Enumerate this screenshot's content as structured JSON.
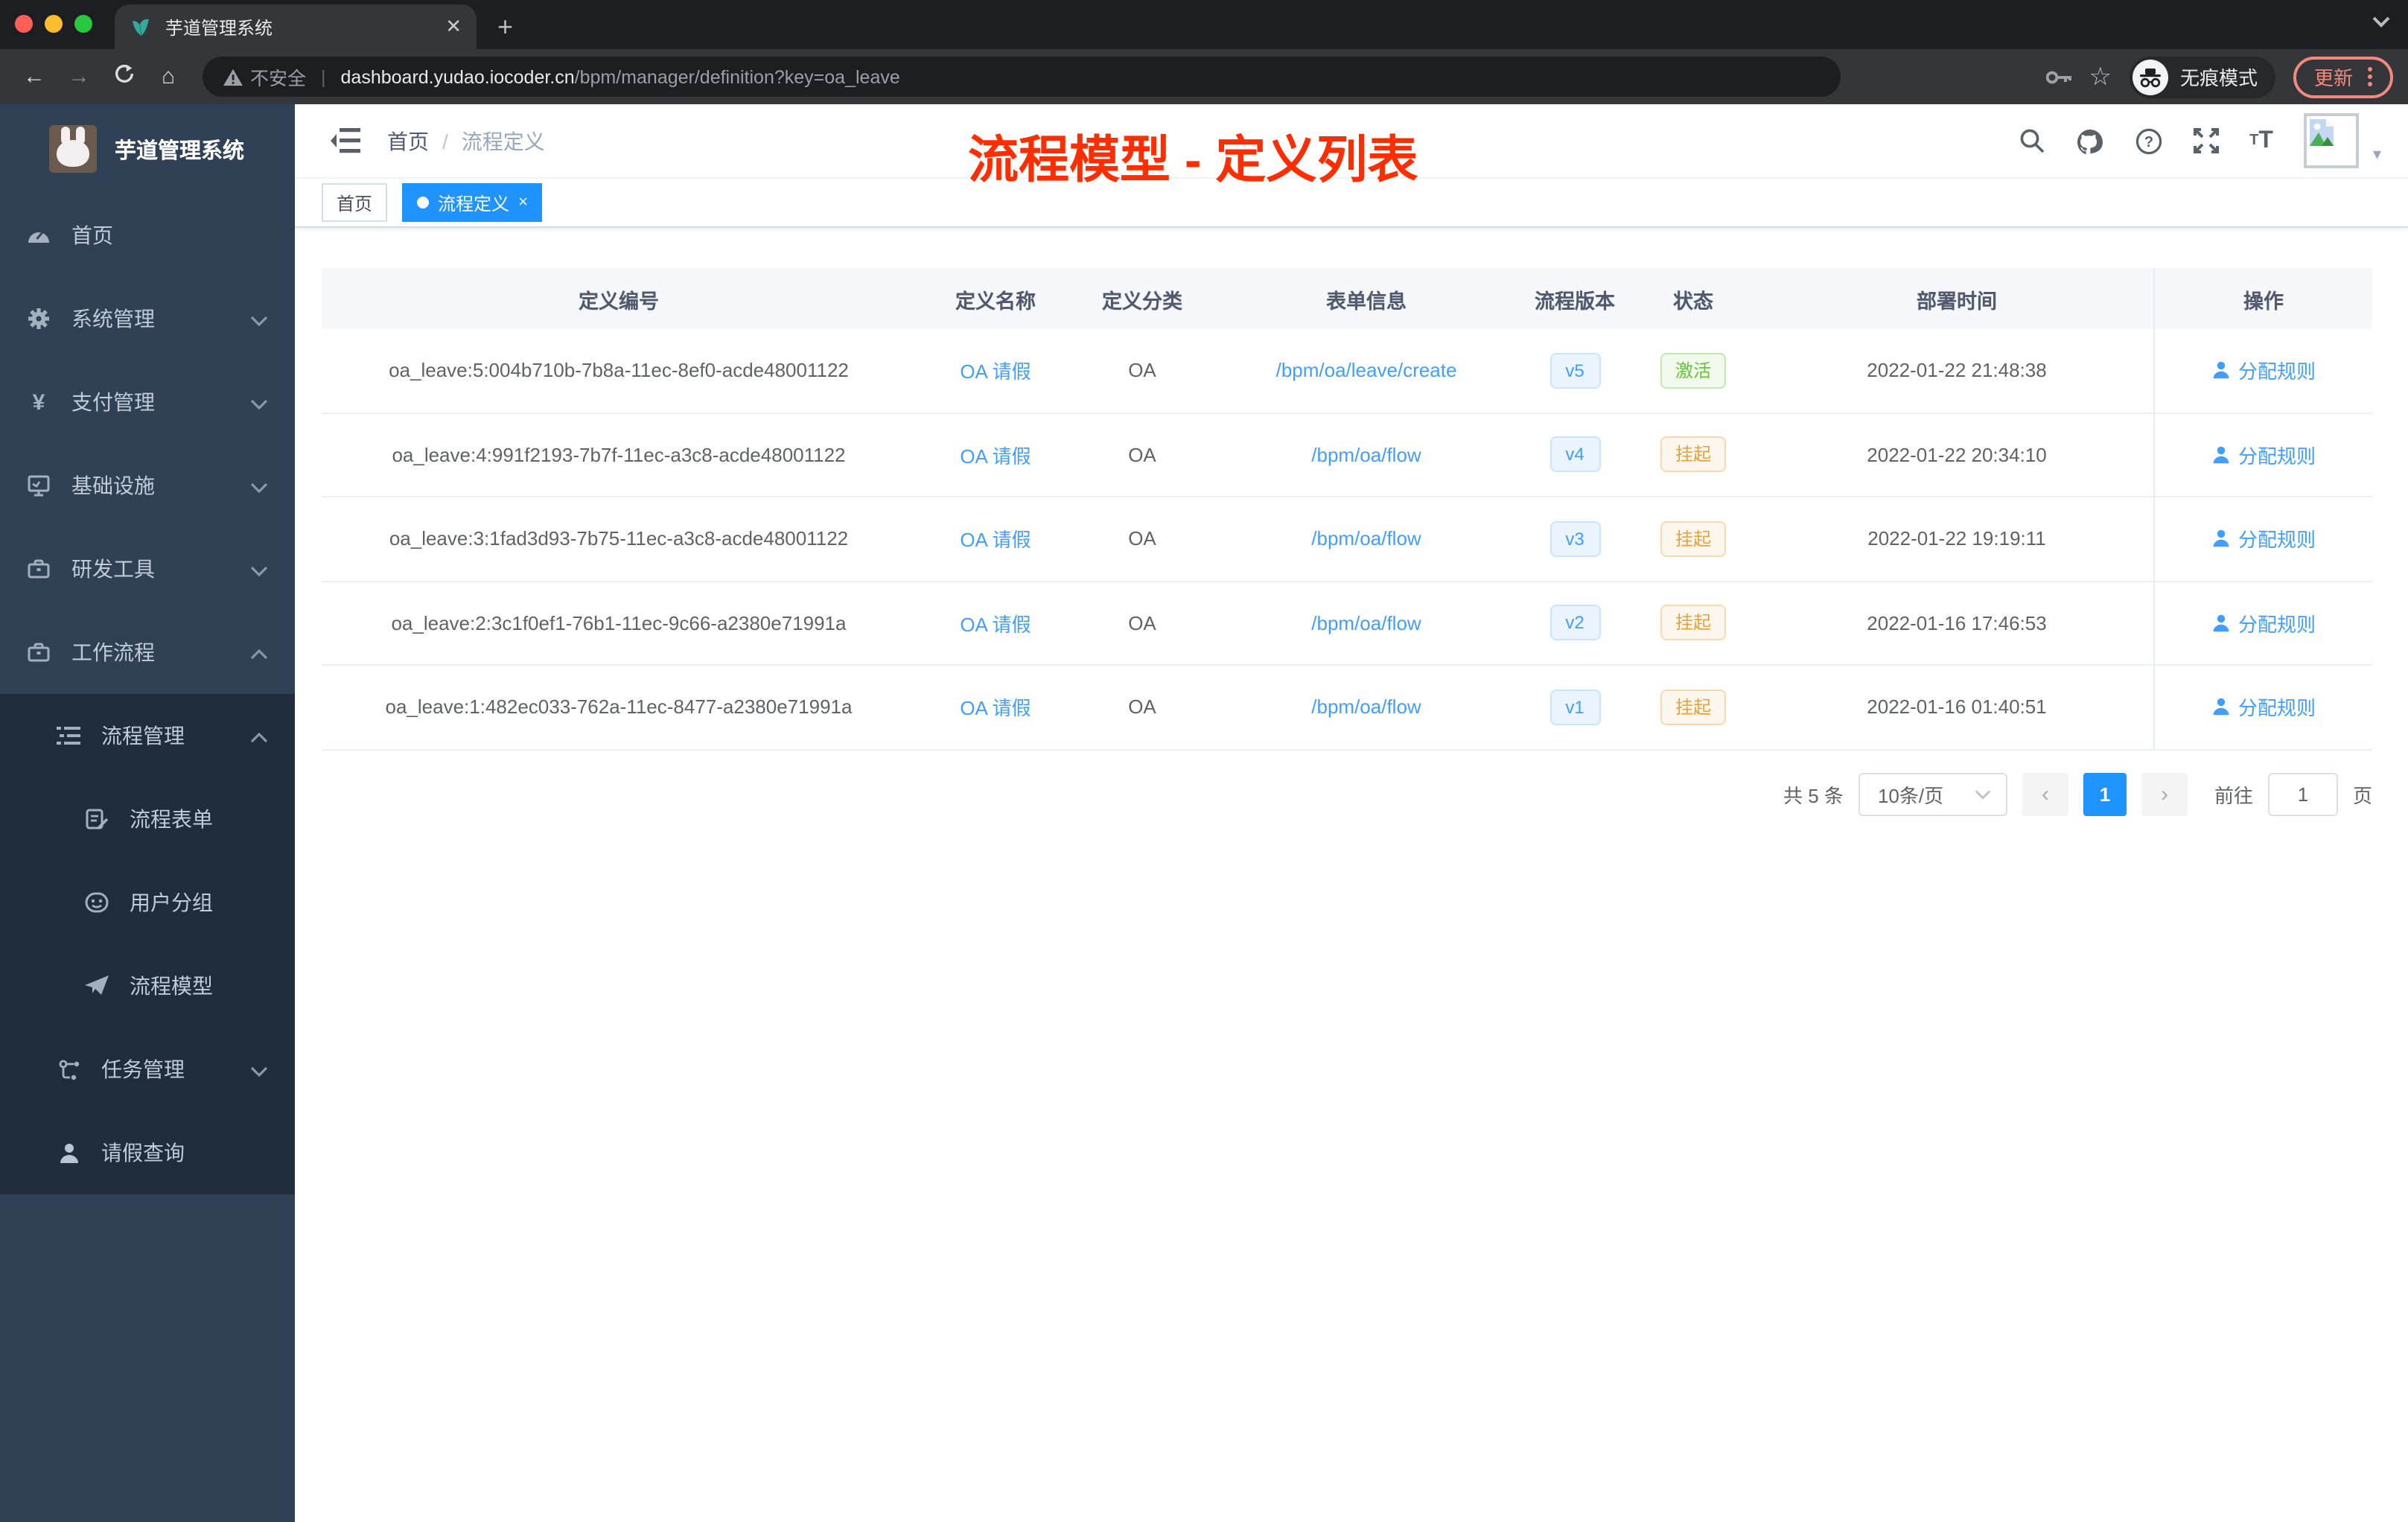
{
  "browser": {
    "tab_title": "芋道管理系统",
    "url": {
      "security_label": "不安全",
      "host": "dashboard.yudao.iocoder.cn",
      "path": "/bpm/manager/definition?key=oa_leave"
    },
    "incognito_label": "无痕模式",
    "update_button_label": "更新"
  },
  "sidebar": {
    "app_title": "芋道管理系统",
    "items": [
      {
        "label": "首页",
        "icon": "dashboard-icon",
        "level": 1,
        "chevron": null
      },
      {
        "label": "系统管理",
        "icon": "gear-icon",
        "level": 1,
        "chevron": "down"
      },
      {
        "label": "支付管理",
        "icon": "yen-icon",
        "level": 1,
        "chevron": "down"
      },
      {
        "label": "基础设施",
        "icon": "monitor-icon",
        "level": 1,
        "chevron": "down"
      },
      {
        "label": "研发工具",
        "icon": "toolbox-icon",
        "level": 1,
        "chevron": "down"
      },
      {
        "label": "工作流程",
        "icon": "toolbox-icon",
        "level": 1,
        "chevron": "up"
      },
      {
        "label": "流程管理",
        "icon": "tree-list-icon",
        "level": 2,
        "chevron": "up"
      },
      {
        "label": "流程表单",
        "icon": "form-icon",
        "level": 3,
        "chevron": null
      },
      {
        "label": "用户分组",
        "icon": "face-icon",
        "level": 3,
        "chevron": null
      },
      {
        "label": "流程模型",
        "icon": "paper-plane-icon",
        "level": 3,
        "chevron": null
      },
      {
        "label": "任务管理",
        "icon": "flow-icon",
        "level": 2,
        "chevron": "down"
      },
      {
        "label": "请假查询",
        "icon": "person-icon",
        "level": 2,
        "chevron": null
      }
    ]
  },
  "header": {
    "breadcrumb": {
      "home": "首页",
      "current": "流程定义"
    },
    "annotation": "流程模型 - 定义列表"
  },
  "tags_view": {
    "tabs": [
      {
        "label": "首页",
        "active": false
      },
      {
        "label": "流程定义",
        "active": true
      }
    ]
  },
  "table": {
    "columns": [
      "定义编号",
      "定义名称",
      "定义分类",
      "表单信息",
      "流程版本",
      "状态",
      "部署时间",
      "操作"
    ],
    "action_label": "分配规则",
    "rows": [
      {
        "id": "oa_leave:5:004b710b-7b8a-11ec-8ef0-acde48001122",
        "name": "OA 请假",
        "category": "OA",
        "form": "/bpm/oa/leave/create",
        "version": "v5",
        "status": "激活",
        "status_type": "success",
        "deploy_time": "2022-01-22 21:48:38"
      },
      {
        "id": "oa_leave:4:991f2193-7b7f-11ec-a3c8-acde48001122",
        "name": "OA 请假",
        "category": "OA",
        "form": "/bpm/oa/flow",
        "version": "v4",
        "status": "挂起",
        "status_type": "warning",
        "deploy_time": "2022-01-22 20:34:10"
      },
      {
        "id": "oa_leave:3:1fad3d93-7b75-11ec-a3c8-acde48001122",
        "name": "OA 请假",
        "category": "OA",
        "form": "/bpm/oa/flow",
        "version": "v3",
        "status": "挂起",
        "status_type": "warning",
        "deploy_time": "2022-01-22 19:19:11"
      },
      {
        "id": "oa_leave:2:3c1f0ef1-76b1-11ec-9c66-a2380e71991a",
        "name": "OA 请假",
        "category": "OA",
        "form": "/bpm/oa/flow",
        "version": "v2",
        "status": "挂起",
        "status_type": "warning",
        "deploy_time": "2022-01-16 17:46:53"
      },
      {
        "id": "oa_leave:1:482ec033-762a-11ec-8477-a2380e71991a",
        "name": "OA 请假",
        "category": "OA",
        "form": "/bpm/oa/flow",
        "version": "v1",
        "status": "挂起",
        "status_type": "warning",
        "deploy_time": "2022-01-16 01:40:51"
      }
    ]
  },
  "pagination": {
    "total_label": "共 5 条",
    "page_size": "10条/页",
    "current_page": "1",
    "goto_label": "前往",
    "goto_value": "1",
    "page_unit": "页"
  },
  "colors": {
    "accent": "#409eff",
    "active_blue": "#1f93ff",
    "success": "#67c23a",
    "warning": "#e6a23c",
    "annotation_red": "#ff2e00",
    "sidebar_bg": "#304156",
    "submenu_bg": "#1f2d3d",
    "chrome_dark": "#1d1e21",
    "toolbar_dark": "#35363a"
  }
}
